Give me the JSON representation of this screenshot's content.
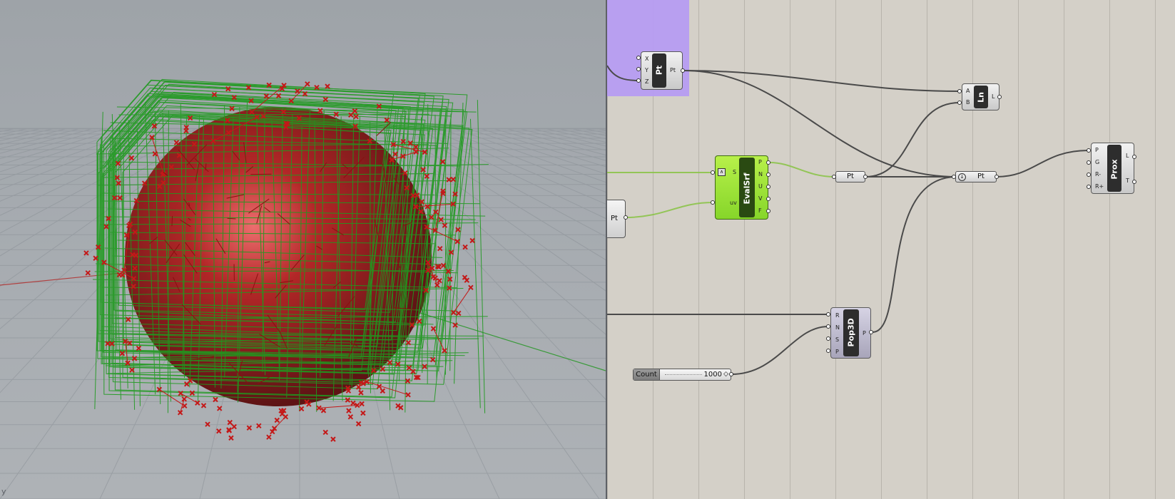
{
  "viewport": {
    "axis_label": "y"
  },
  "canvas": {
    "components": {
      "pt": {
        "name": "Pt",
        "inputs": [
          "X",
          "Y",
          "Z"
        ],
        "outputs": [
          "Pt"
        ]
      },
      "ln": {
        "name": "Ln",
        "inputs": [
          "A",
          "B"
        ],
        "outputs": [
          "L"
        ]
      },
      "evalsrf": {
        "name": "EvalSrf",
        "inputs": [
          "S",
          "uv"
        ],
        "outputs": [
          "P",
          "N",
          "U",
          "V",
          "F"
        ]
      },
      "prox": {
        "name": "Prox",
        "inputs": [
          "P",
          "G",
          "R-",
          "R+"
        ],
        "outputs": [
          "L",
          "T"
        ]
      },
      "pop3d": {
        "name": "Pop3D",
        "inputs": [
          "R",
          "N",
          "S",
          "P"
        ],
        "outputs": [
          "P"
        ]
      }
    },
    "params": {
      "pt_left": "Pt",
      "pt_mid": "Pt",
      "pt_right": "Pt"
    },
    "slider": {
      "label": "Count",
      "value": "1000"
    }
  },
  "colors": {
    "canvas_bg": "#d4d0c8",
    "group": "#b69cf2",
    "evalsrf": "#9be23a",
    "mesh_red": "#c41818",
    "mesh_green": "#1f9a1f"
  }
}
